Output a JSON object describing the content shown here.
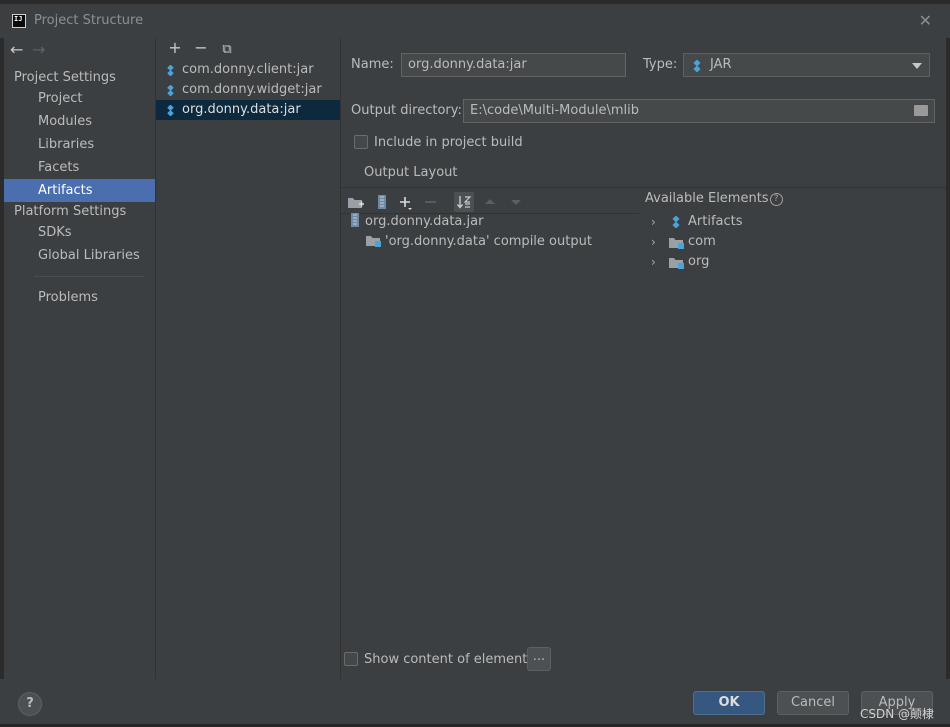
{
  "window": {
    "title": "Project Structure",
    "app_icon_text": "IJ"
  },
  "nav": {
    "back": "←",
    "forward": "→",
    "project_settings_label": "Project Settings",
    "platform_settings_label": "Platform Settings",
    "items": [
      "Project",
      "Modules",
      "Libraries",
      "Facets",
      "Artifacts"
    ],
    "platform_items": [
      "SDKs",
      "Global Libraries"
    ],
    "problems": "Problems",
    "selected": "Artifacts"
  },
  "artifacts_toolbar": {
    "add": "+",
    "remove": "−",
    "copy": "⧉"
  },
  "artifacts": [
    "com.donny.client:jar",
    "com.donny.widget:jar",
    "org.donny.data:jar"
  ],
  "selected_artifact": "org.donny.data:jar",
  "form": {
    "name_label": "Name:",
    "name_value": "org.donny.data:jar",
    "type_label": "Type:",
    "type_value": "JAR",
    "output_dir_label": "Output directory:",
    "output_dir_value": "E:\\code\\Multi-Module\\mlib",
    "include_in_build_label": "Include in project build",
    "include_in_build_checked": false,
    "output_layout_label": "Output Layout"
  },
  "layout_tree": {
    "root": "org.donny.data.jar",
    "children": [
      "'org.donny.data' compile output"
    ]
  },
  "available": {
    "label": "Available Elements",
    "items": [
      "Artifacts",
      "com",
      "org"
    ]
  },
  "show_content_label": "Show content of elements",
  "show_content_checked": false,
  "more_button": "...",
  "footer": {
    "help": "?",
    "ok": "OK",
    "cancel": "Cancel",
    "apply": "Apply"
  },
  "watermark": "CSDN @颠棣",
  "colors": {
    "selection": "#4b6eaf",
    "primary_button": "#365880",
    "jar_icon": "#4aa3d9"
  }
}
